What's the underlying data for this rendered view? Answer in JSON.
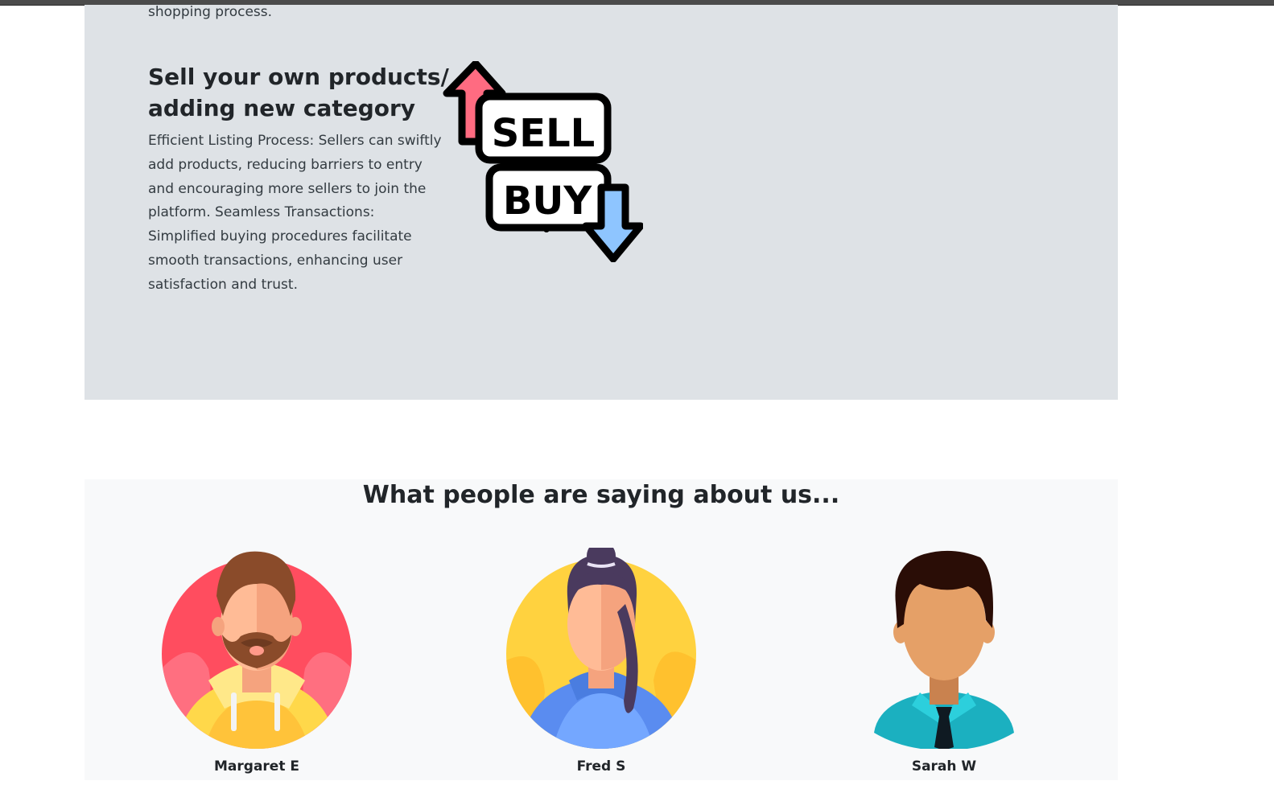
{
  "previous_section": {
    "text_tail": "shopping process."
  },
  "feature": {
    "heading": "Sell your own products/ adding new category",
    "body": "Efficient Listing Process: Sellers can swiftly add products, reducing barriers to entry and encouraging more sellers to join the platform. Seamless Transactions: Simplified buying procedures facilitate smooth transactions, enhancing user satisfaction and trust.",
    "illustration": {
      "top_label": "SELL",
      "bottom_label": "BUY"
    }
  },
  "testimonials": {
    "heading": "What people are saying about us...",
    "people": [
      {
        "name": "Margaret E",
        "avatar": "bearded-man-avatar"
      },
      {
        "name": "Fred S",
        "avatar": "ponytail-woman-avatar"
      },
      {
        "name": "Sarah W",
        "avatar": "man-with-tie-avatar"
      }
    ]
  },
  "colors": {
    "feature_bg": "#dee2e6",
    "testimonials_bg": "#f8f9fa",
    "sell_arrow": "#ff6b81",
    "buy_arrow": "#8ec5ff"
  }
}
